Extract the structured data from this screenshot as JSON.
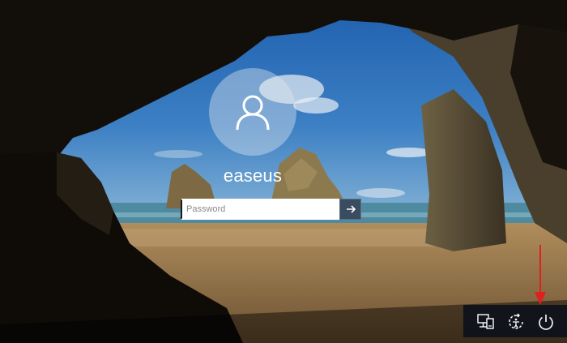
{
  "user": {
    "name": "easeus",
    "avatar_icon": "user-silhouette-icon"
  },
  "password": {
    "placeholder": "Password",
    "value": "",
    "submit_icon": "arrow-right-icon"
  },
  "system_buttons": [
    {
      "name": "network",
      "icon": "network-icon"
    },
    {
      "name": "ease-of-access",
      "icon": "ease-of-access-icon"
    },
    {
      "name": "power",
      "icon": "power-icon"
    }
  ],
  "annotation": {
    "color": "#e02020",
    "target": "power"
  },
  "colors": {
    "sky": "#2f6fb5",
    "sea": "#4e8aa0",
    "sand": "#9a7a4c",
    "cave": "#211a12"
  }
}
